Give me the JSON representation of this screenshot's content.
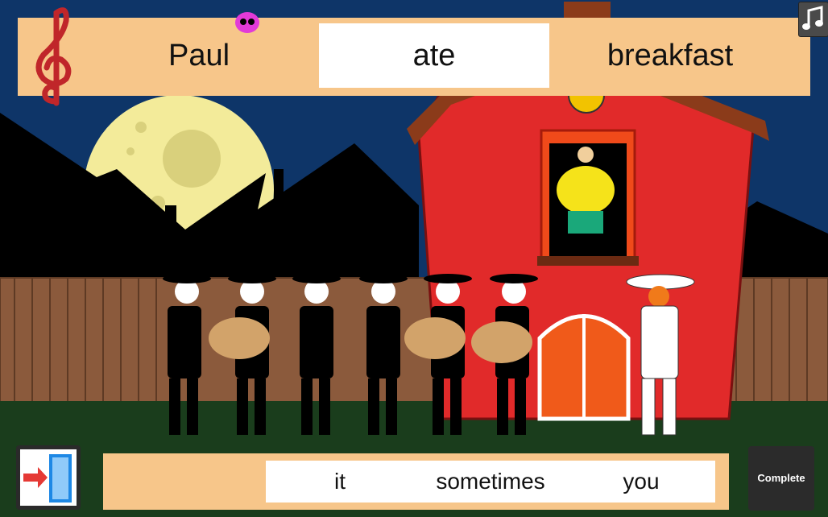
{
  "sentence": {
    "words": [
      "Paul",
      "ate",
      "breakfast"
    ]
  },
  "options": {
    "words": [
      "it",
      "sometimes",
      "you"
    ]
  },
  "buttons": {
    "complete_label": "Complete"
  },
  "icons": {
    "clef": "treble-clef-icon",
    "music": "music-note-icon",
    "exit": "exit-door-icon",
    "skull": "skull-icon"
  },
  "colors": {
    "banner": "#f7c68a",
    "sky": "#0e3568",
    "house": "#e12a2a",
    "moon": "#f3eb9a",
    "fence": "#8b5a3c",
    "grass": "#1a3d1c"
  }
}
